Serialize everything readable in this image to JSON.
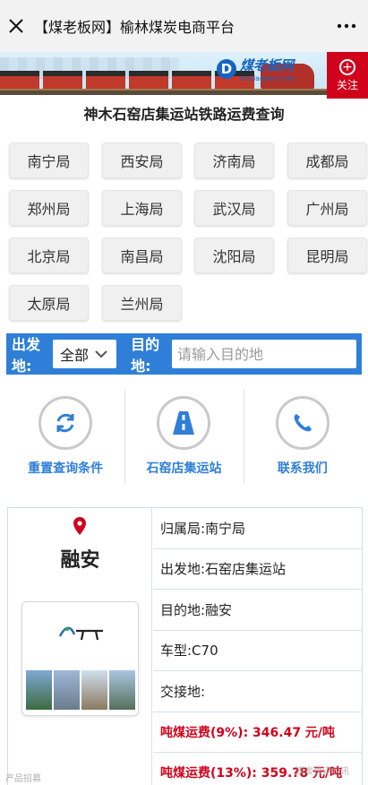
{
  "nav": {
    "title": "【煤老板网】榆林煤炭电商平台"
  },
  "banner": {
    "brand": "煤老板网",
    "url": "meilaoban.com",
    "follow_label": "关注"
  },
  "page_title": "神木石窑店集运站铁路运费查询",
  "bureaus": [
    "南宁局",
    "西安局",
    "济南局",
    "成都局",
    "郑州局",
    "上海局",
    "武汉局",
    "广州局",
    "北京局",
    "南昌局",
    "沈阳局",
    "昆明局",
    "太原局",
    "兰州局"
  ],
  "search": {
    "origin_label": "出发地:",
    "origin_value": "全部",
    "dest_label": "目的地:",
    "dest_placeholder": "请输入目的地"
  },
  "actions": [
    {
      "label": "重置查询条件",
      "icon": "refresh-icon"
    },
    {
      "label": "石窑店集运站",
      "icon": "road-icon"
    },
    {
      "label": "联系我们",
      "icon": "phone-icon"
    }
  ],
  "result": {
    "city": "融安",
    "rows": [
      "归属局:南宁局",
      "出发地:石窑店集运站",
      "目的地:融安",
      "车型:C70",
      "交接地:",
      "吨煤运费(9%): 346.47 元/吨",
      "吨煤运费(13%): 359.?8 元/吨"
    ]
  },
  "colors": {
    "accent": "#2f7fd8",
    "alert": "#d0021b"
  },
  "watermarks": {
    "left": "产品招募",
    "right": "煤炭资讯快讯"
  }
}
